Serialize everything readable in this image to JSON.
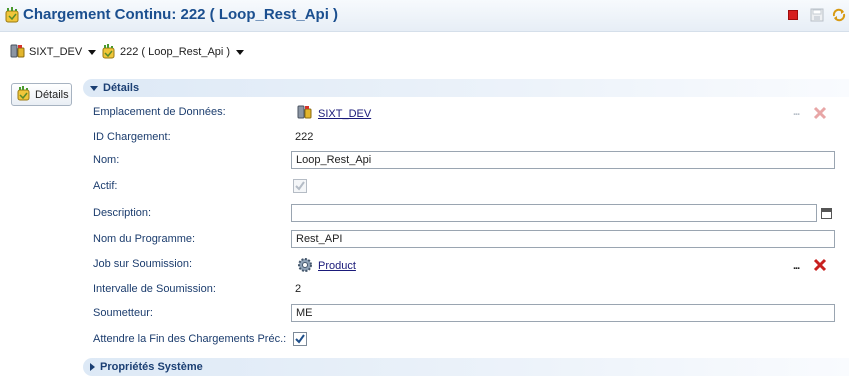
{
  "window": {
    "title": "Chargement Continu: 222 ( Loop_Rest_Api )"
  },
  "toolbar": {
    "stop_icon": "stop-icon",
    "save_icon": "save-icon",
    "refresh_icon": "refresh-icon"
  },
  "breadcrumb": {
    "datasource": "SIXT_DEV",
    "load": "222 ( Loop_Rest_Api )"
  },
  "side_tab": {
    "label": "Détails"
  },
  "sections": {
    "details": {
      "title": "Détails",
      "expanded": true
    },
    "system": {
      "title": "Propriétés Système",
      "expanded": false
    }
  },
  "fields": {
    "emplacement": {
      "label": "Emplacement de Données:",
      "value": "SIXT_DEV"
    },
    "id": {
      "label": "ID Chargement:",
      "value": "222"
    },
    "nom": {
      "label": "Nom:",
      "value": "Loop_Rest_Api"
    },
    "actif": {
      "label": "Actif:",
      "checked": true
    },
    "description": {
      "label": "Description:",
      "value": ""
    },
    "programme": {
      "label": "Nom du Programme:",
      "value": "Rest_API"
    },
    "job": {
      "label": "Job sur Soumission:",
      "value": "Product"
    },
    "intervalle": {
      "label": "Intervalle de Soumission:",
      "value": "2"
    },
    "soumetteur": {
      "label": "Soumetteur:",
      "value": "ME"
    },
    "attendre": {
      "label": "Attendre la Fin des Chargements Préc.:",
      "checked": true
    }
  },
  "colors": {
    "title": "#1b4f8f",
    "label": "#1c3d6e",
    "delete_red": "#c8201f"
  }
}
